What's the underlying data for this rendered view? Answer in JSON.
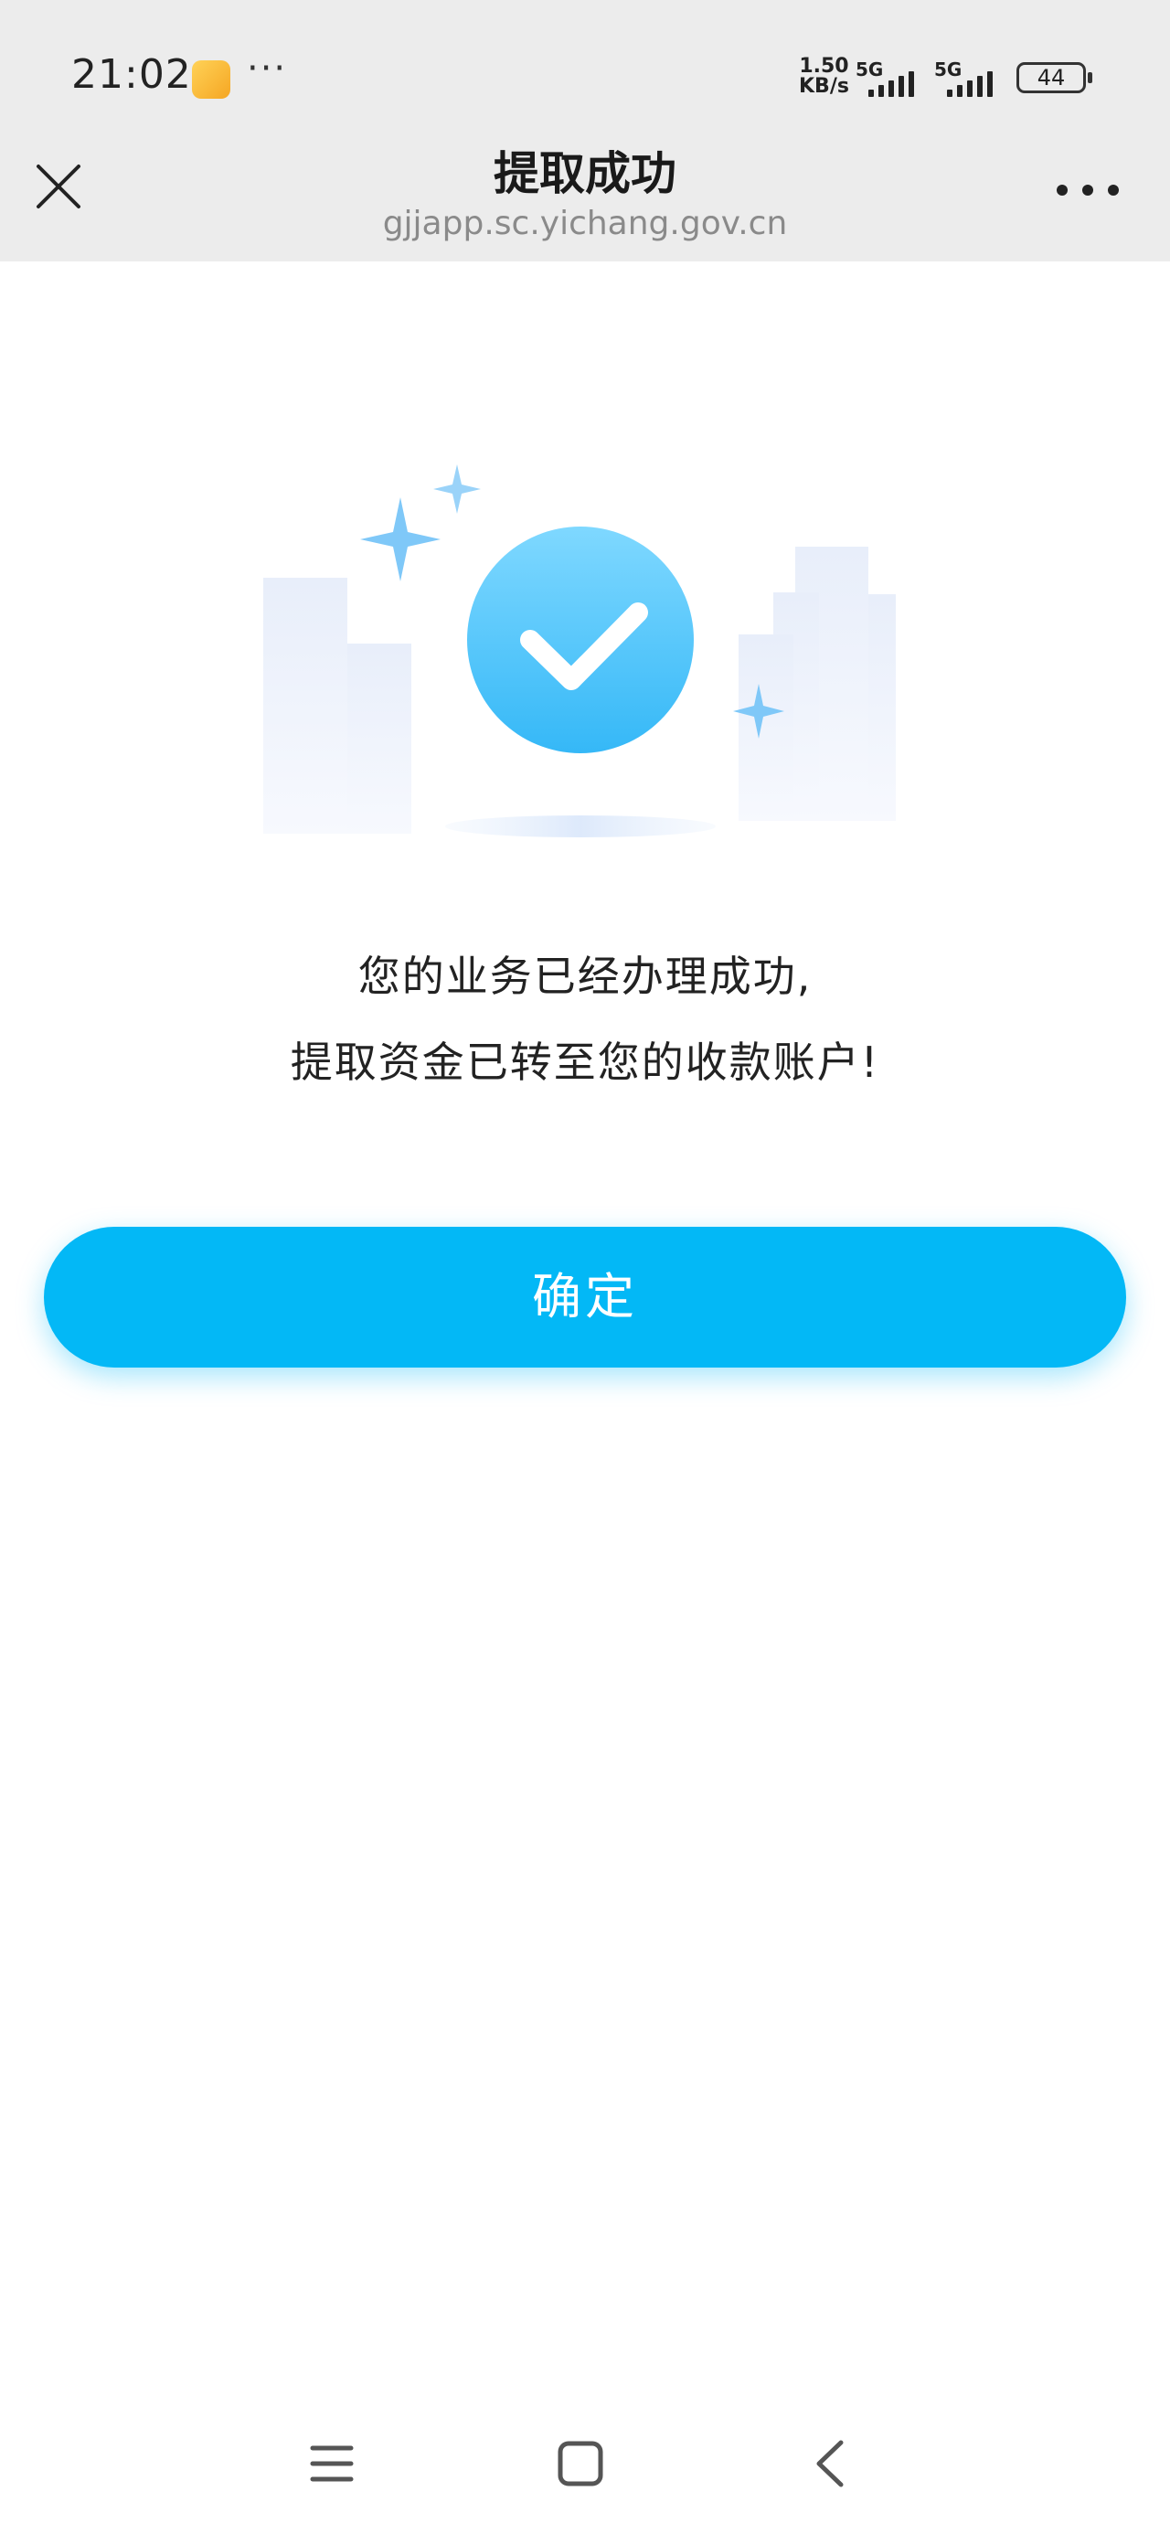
{
  "status_bar": {
    "time": "21:02",
    "net_speed_value": "1.50",
    "net_speed_unit": "KB/s",
    "signal1_label": "5G",
    "signal2_label": "5G",
    "battery": "44"
  },
  "header": {
    "title": "提取成功",
    "url": "gjjapp.sc.yichang.gov.cn"
  },
  "main": {
    "message_line1": "您的业务已经办理成功,",
    "message_line2": "提取资金已转至您的收款账户!",
    "confirm_label": "确定"
  },
  "colors": {
    "accent": "#03b8f6",
    "check_circle_top": "#7fd8ff",
    "check_circle_bottom": "#35b8f7",
    "header_bg": "#ececec"
  },
  "icons": {
    "close": "close-icon",
    "more": "more-icon",
    "success": "check-circle-icon",
    "sys_menu": "menu-icon",
    "sys_home": "home-icon",
    "sys_back": "back-icon"
  }
}
